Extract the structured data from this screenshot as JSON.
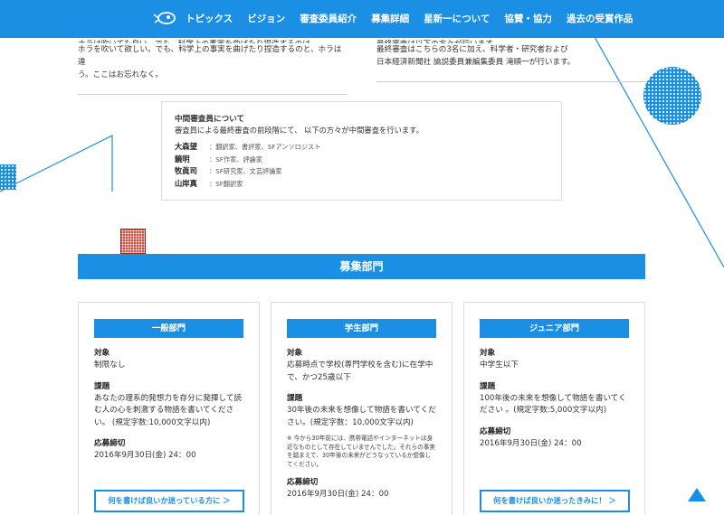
{
  "nav": {
    "logo_icon": "rocket-logo-icon",
    "items": [
      "トピックス",
      "ビジョン",
      "審査委員紹介",
      "募集詳細",
      "星新一について",
      "協賛・協力",
      "過去の受賞作品"
    ]
  },
  "intro": {
    "left_clip": "ホラは吹いても良い。でも、科学上の事実を曲げたり捏造するのは",
    "left_lines": [
      "ホラを吹いて欲しい。でも、科学上の事実を曲げたり捏造するのと、ホラは違",
      "う。ここはお忘れなく。"
    ],
    "right_clip": "最終審査は以下の方々が行います。",
    "right_lines": [
      "最終審査はこちらの3名に加え、科学者・研究者および",
      "日本経済新聞社 論説委員兼編集委員 滝順一が行います。"
    ]
  },
  "midterm": {
    "heading": "中間審査員について",
    "desc": "審査員による最終審査の前段階にて、 以下の方々が中間審査を行います。",
    "members": [
      {
        "name": "大森望",
        "role": "：翻訳家、書評家、SFアンソロジスト"
      },
      {
        "name": "鏡明",
        "role": "：SF作家、評論家"
      },
      {
        "name": "牧眞司",
        "role": "：SF研究家、文芸評論家"
      },
      {
        "name": "山岸真",
        "role": "：SF翻訳家"
      }
    ]
  },
  "banner": {
    "title": "募集部門"
  },
  "cards": [
    {
      "tag": "一般部門",
      "target_label": "対象",
      "target": "制限なし",
      "theme_label": "課題",
      "theme": "あなたの理系的発想力を存分に発揮して読む人の心を刺激する物語を書いてください。 (規定字数:10,000文字以内)",
      "deadline_label": "応募締切",
      "deadline": "2016年9月30日(金) 24：00",
      "cta": "何を書けば良いか迷っている方に ＞"
    },
    {
      "tag": "学生部門",
      "target_label": "対象",
      "target": "応募時点で学校(専門学校を含む)に在学中で、かつ25歳以下",
      "theme_label": "課題",
      "theme": "30年後の未来を想像して物語を書いてください。(規定字数：10,000文字以内)",
      "note": "※ 今から30年前には、携帯電話やインターネットは身近なものとして存在していませんでした。それらの事実を踏まえて、30年後の未来がどうなっているか想像してください。",
      "deadline_label": "応募締切",
      "deadline": "2016年9月30日(金) 24：00"
    },
    {
      "tag": "ジュニア部門",
      "target_label": "対象",
      "target": "中学生以下",
      "theme_label": "課題",
      "theme": "100年後の未来を想像して物語を書いてください 。(規定字数:5,000文字以内)",
      "deadline_label": "応募締切",
      "deadline": "2016年9月30日(金) 24：00",
      "cta": "何を書けば良いか迷ったきみに！ ＞"
    }
  ],
  "colors": {
    "accent": "#1a8fe3",
    "red_square": "#c94a3a"
  }
}
